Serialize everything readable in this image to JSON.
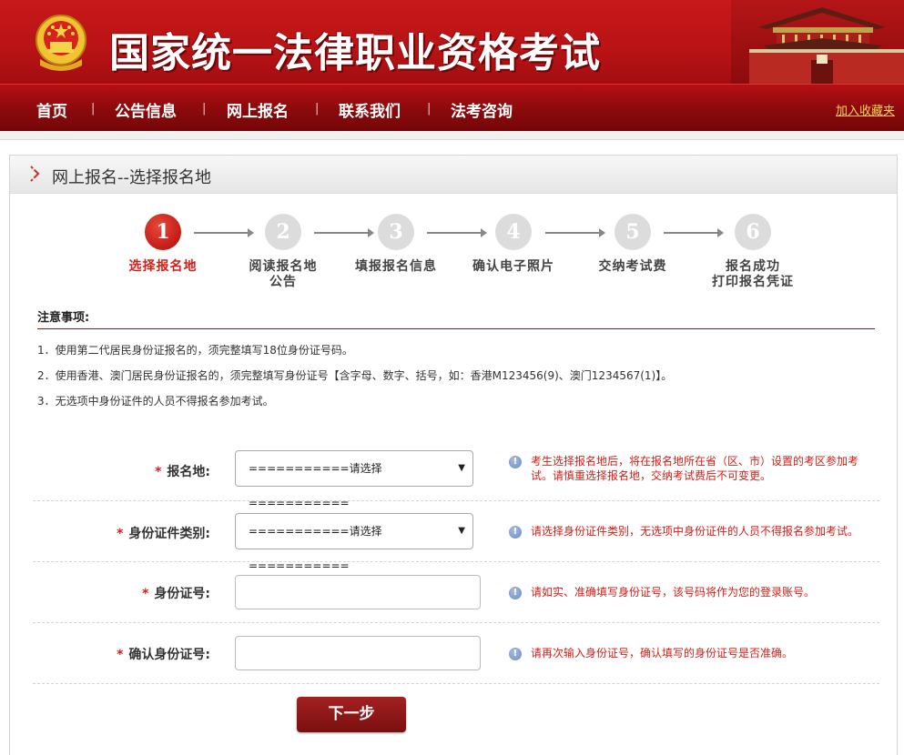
{
  "header": {
    "site_title": "国家统一法律职业资格考试"
  },
  "nav": {
    "items": [
      "首页",
      "公告信息",
      "网上报名",
      "联系我们",
      "法考咨询"
    ],
    "separator": "|",
    "favorite": "加入收藏夹"
  },
  "panel": {
    "title": "网上报名--选择报名地"
  },
  "steps": [
    {
      "num": "1",
      "label_line1": "选择报名地",
      "label_line2": ""
    },
    {
      "num": "2",
      "label_line1": "阅读报名地",
      "label_line2": "公告"
    },
    {
      "num": "3",
      "label_line1": "填报报名信息",
      "label_line2": ""
    },
    {
      "num": "4",
      "label_line1": "确认电子照片",
      "label_line2": ""
    },
    {
      "num": "5",
      "label_line1": "交纳考试费",
      "label_line2": ""
    },
    {
      "num": "6",
      "label_line1": "报名成功",
      "label_line2": "打印报名凭证"
    }
  ],
  "notes": {
    "title": "注意事项:",
    "items": [
      "1．使用第二代居民身份证报名的，须完整填写18位身份证号码。",
      "2．使用香港、澳门居民身份证报名的，须完整填写身份证号【含字母、数字、括号，如：香港M123456(9)、澳门1234567(1)】。",
      "3．无选项中身份证件的人员不得报名参加考试。"
    ]
  },
  "form": {
    "required_mark": "*",
    "select_placeholder": "===========请选择===========",
    "rows": [
      {
        "label": "报名地:",
        "hint_line1": "考生选择报名地后，将在报名地所在省（区、市）设置的考区参加考",
        "hint_line2": "试。请慎重选择报名地，交纳考试费后不可变更。"
      },
      {
        "label": "身份证件类别:",
        "hint_line1": "请选择身份证件类别，无选项中身份证件的人员不得报名参加考试。",
        "hint_line2": ""
      },
      {
        "label": "身份证号:",
        "hint_line1": "请如实、准确填写身份证号，该号码将作为您的登录账号。",
        "hint_line2": ""
      },
      {
        "label": "确认身份证号:",
        "hint_line1": "请再次输入身份证号，确认填写的身份证号是否准确。",
        "hint_line2": ""
      }
    ],
    "next_button": "下一步"
  },
  "colors": {
    "header_red": "#c8181a",
    "nav_dark_red": "#8e0a0c",
    "accent_red": "#d21f17",
    "favorite_yellow": "#f7d35a"
  }
}
